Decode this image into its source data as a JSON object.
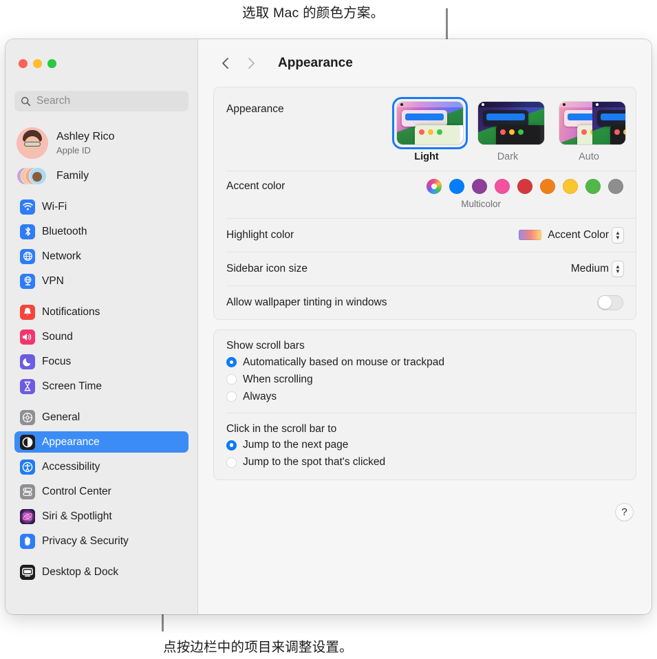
{
  "annotations": {
    "top": "选取 Mac 的颜色方案。",
    "bottom": "点按边栏中的项目来调整设置。"
  },
  "window": {
    "traffic_lights": [
      "close",
      "minimize",
      "zoom"
    ],
    "toolbar": {
      "back_icon": "chevron-left-icon",
      "forward_icon": "chevron-right-icon",
      "title": "Appearance"
    }
  },
  "sidebar": {
    "search": {
      "placeholder": "Search",
      "icon": "search-icon"
    },
    "account": {
      "name": "Ashley Rico",
      "subtitle": "Apple ID",
      "avatar": "memoji-avatar"
    },
    "family": {
      "label": "Family",
      "icon": "family-avatars"
    },
    "groups": [
      {
        "items": [
          {
            "label": "Wi-Fi",
            "icon": "wifi-icon",
            "color": "#2f7cf6",
            "selected": false
          },
          {
            "label": "Bluetooth",
            "icon": "bluetooth-icon",
            "color": "#2f7cf6",
            "selected": false
          },
          {
            "label": "Network",
            "icon": "globe-icon",
            "color": "#2f7cf6",
            "selected": false
          },
          {
            "label": "VPN",
            "icon": "vpn-icon",
            "color": "#2f7cf6",
            "selected": false
          }
        ]
      },
      {
        "items": [
          {
            "label": "Notifications",
            "icon": "bell-icon",
            "color": "#f5453b",
            "selected": false
          },
          {
            "label": "Sound",
            "icon": "speaker-icon",
            "color": "#f4356b",
            "selected": false
          },
          {
            "label": "Focus",
            "icon": "moon-icon",
            "color": "#6b5ce0",
            "selected": false
          },
          {
            "label": "Screen Time",
            "icon": "hourglass-icon",
            "color": "#6b5ce0",
            "selected": false
          }
        ]
      },
      {
        "items": [
          {
            "label": "General",
            "icon": "gear-icon",
            "color": "#8e8e93",
            "selected": false
          },
          {
            "label": "Appearance",
            "icon": "appearance-icon",
            "color": "#1d1d1f",
            "selected": true
          },
          {
            "label": "Accessibility",
            "icon": "accessibility-icon",
            "color": "#1f7cf2",
            "selected": false
          },
          {
            "label": "Control Center",
            "icon": "control-center-icon",
            "color": "#8e8e93",
            "selected": false
          },
          {
            "label": "Siri & Spotlight",
            "icon": "siri-icon",
            "color": "#3a2a4a",
            "selected": false
          },
          {
            "label": "Privacy & Security",
            "icon": "hand-icon",
            "color": "#2f7cf6",
            "selected": false
          }
        ]
      },
      {
        "items": [
          {
            "label": "Desktop & Dock",
            "icon": "desktop-dock-icon",
            "color": "#1d1d1f",
            "selected": false
          }
        ]
      }
    ]
  },
  "main": {
    "appearance": {
      "label": "Appearance",
      "themes": [
        {
          "name": "Light",
          "selected": true
        },
        {
          "name": "Dark",
          "selected": false
        },
        {
          "name": "Auto",
          "selected": false
        }
      ]
    },
    "accent_color": {
      "label": "Accent color",
      "caption": "Multicolor",
      "selected_index": 0,
      "swatches": [
        {
          "name": "multicolor",
          "color": "multicolor"
        },
        {
          "name": "blue",
          "color": "#067dfb"
        },
        {
          "name": "purple",
          "color": "#8c4099"
        },
        {
          "name": "pink",
          "color": "#f2529e"
        },
        {
          "name": "red",
          "color": "#d5383c"
        },
        {
          "name": "orange",
          "color": "#ef8019"
        },
        {
          "name": "yellow",
          "color": "#fbc52d"
        },
        {
          "name": "green",
          "color": "#51b748"
        },
        {
          "name": "graphite",
          "color": "#8e8e8e"
        }
      ]
    },
    "highlight_color": {
      "label": "Highlight color",
      "value": "Accent Color",
      "chip": "gradient-chip"
    },
    "sidebar_icon_size": {
      "label": "Sidebar icon size",
      "value": "Medium"
    },
    "wallpaper_tinting": {
      "label": "Allow wallpaper tinting in windows",
      "enabled": false
    },
    "scroll_bars": {
      "title": "Show scroll bars",
      "options": [
        {
          "label": "Automatically based on mouse or trackpad",
          "selected": true
        },
        {
          "label": "When scrolling",
          "selected": false
        },
        {
          "label": "Always",
          "selected": false
        }
      ]
    },
    "scroll_click": {
      "title": "Click in the scroll bar to",
      "options": [
        {
          "label": "Jump to the next page",
          "selected": true
        },
        {
          "label": "Jump to the spot that's clicked",
          "selected": false
        }
      ]
    },
    "help": {
      "label": "?",
      "icon": "help-icon"
    }
  }
}
